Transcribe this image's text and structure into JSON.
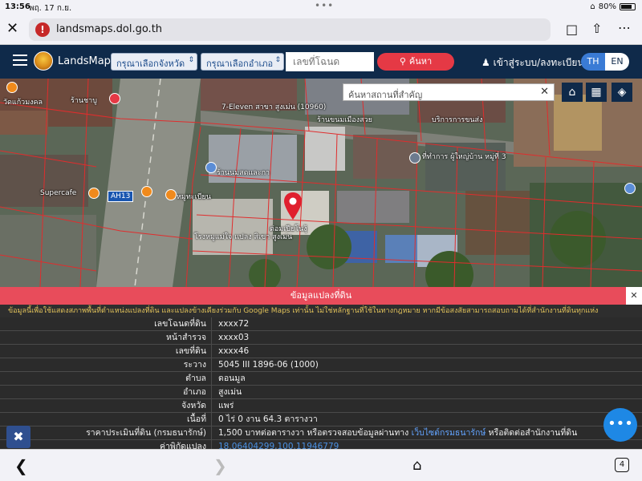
{
  "status_bar": {
    "time": "13:56",
    "date": "พฤ. 17 ก.ย.",
    "battery": "80%",
    "battery_level": 0.8
  },
  "browser": {
    "url": "landsmaps.dol.go.th",
    "tab_count": "4"
  },
  "app": {
    "brand": "LandsMaps",
    "province_select": "กรุณาเลือกจังหวัด",
    "district_select": "กรุณาเลือกอำเภอ",
    "deed_placeholder": "เลขที่โฉนด",
    "search_label": "ค้นหา",
    "login_label": "เข้าสู่ระบบ/ลงทะเบียน",
    "lang_th": "TH",
    "lang_en": "EN"
  },
  "map": {
    "place_search_placeholder": "ค้นหาสถานที่สำคัญ",
    "road_marker": "AH13",
    "pois": [
      {
        "label": "วัดแก้วมงคล"
      },
      {
        "label": "ร้านชาบู"
      },
      {
        "label": "7-Eleven สาขา สูงเม่น (10960)"
      },
      {
        "label": "ร้านขนมเมืองสวย"
      },
      {
        "label": "บริการการขนส่ง"
      },
      {
        "label": "ที่ทำการ ผู้ใหญ่บ้าน หมู่ที่ 3"
      },
      {
        "label": "ร้านนมสดและกา"
      },
      {
        "label": "Supercafe"
      },
      {
        "label": "หมูทะเบียน"
      },
      {
        "label": "โรงหมูแม่ใจ แปลง สิเขา สูงเม่น"
      },
      {
        "label": "ต่อมเปียโนงุ้"
      }
    ]
  },
  "panel": {
    "title": "ข้อมูลแปลงที่ดิน",
    "notice": "ข้อมูลนี้เพื่อใช้แสดงสภาพพื้นที่ตำแหน่งแปลงที่ดิน และแปลงข้างเคียงร่วมกับ Google Maps เท่านั้น ไม่ใช่หลักฐานที่ใช้ในทางกฎหมาย หากมีข้อสงสัยสามารถสอบถามได้ที่สำนักงานที่ดินทุกแห่ง",
    "rows": [
      {
        "key": "เลขโฉนดที่ดิน",
        "value": "xxxx72"
      },
      {
        "key": "หน้าสำรวจ",
        "value": "xxxx03"
      },
      {
        "key": "เลขที่ดิน",
        "value": "xxxx46"
      },
      {
        "key": "ระวาง",
        "value": "5045 III 1896-06 (1000)"
      },
      {
        "key": "ตำบล",
        "value": "ดอนมูล"
      },
      {
        "key": "อำเภอ",
        "value": "สูงเม่น"
      },
      {
        "key": "จังหวัด",
        "value": "แพร่"
      },
      {
        "key": "เนื้อที่",
        "value": "0 ไร่ 0 งาน 64.3 ตารางวา"
      }
    ],
    "price_row": {
      "key": "ราคาประเมินที่ดิน (กรมธนารักษ์)",
      "value_pre": "1,500 บาทต่อตารางวา หรือตรวจสอบข้อมูลผ่านทาง",
      "value_link": "เว็บไซต์กรมธนารักษ์",
      "value_post": "หรือติดต่อสำนักงานที่ดิน"
    },
    "coord_row": {
      "key": "ค่าพิกัดแปลง",
      "value": "18.06404299,100.11946779"
    }
  }
}
